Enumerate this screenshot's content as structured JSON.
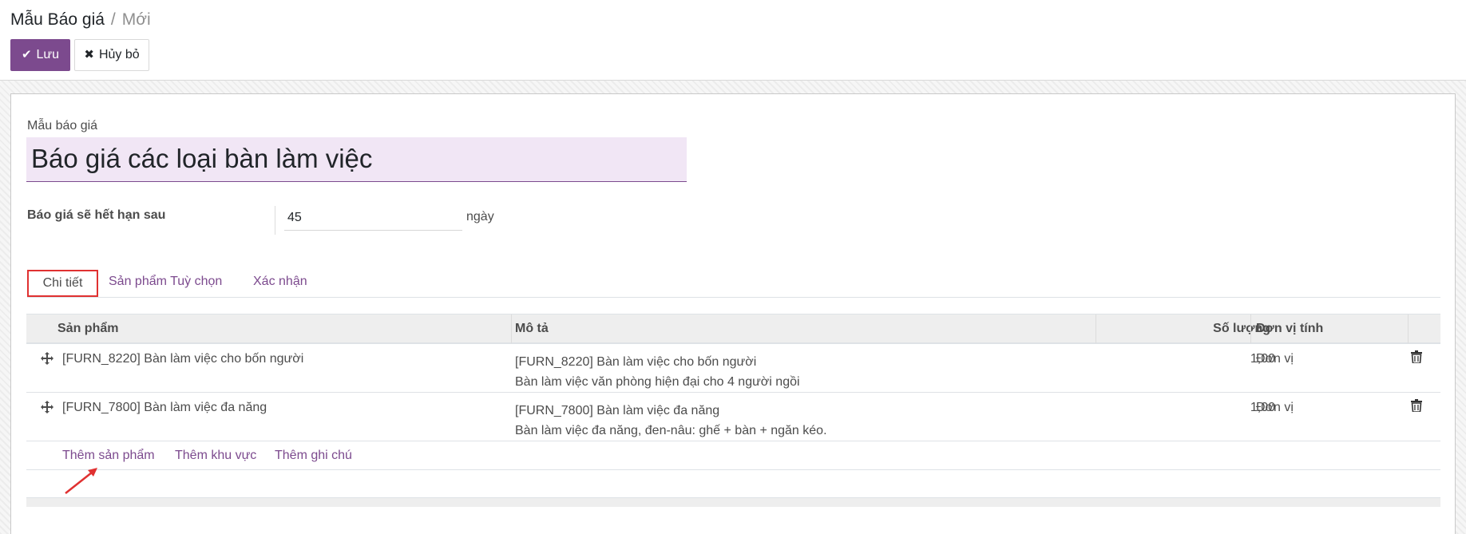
{
  "breadcrumb": {
    "parent": "Mẫu Báo giá",
    "separator": "/",
    "current": "Mới"
  },
  "toolbar": {
    "save_label": "Lưu",
    "discard_label": "Hủy bỏ"
  },
  "form": {
    "name_label": "Mẫu báo giá",
    "name_value": "Báo giá các loại bàn làm việc",
    "expiry_label": "Báo giá sẽ hết hạn sau",
    "expiry_value": "45",
    "expiry_unit": "ngày"
  },
  "tabs": [
    {
      "label": "Chi tiết",
      "active": true
    },
    {
      "label": "Sản phẩm Tuỳ chọn",
      "active": false
    },
    {
      "label": "Xác nhận",
      "active": false
    }
  ],
  "table": {
    "headers": {
      "product": "Sản phẩm",
      "description": "Mô tả",
      "quantity": "Số lượng",
      "uom": "Đơn vị tính"
    },
    "rows": [
      {
        "product": "[FURN_8220] Bàn làm việc cho bốn người",
        "desc_line1": "[FURN_8220] Bàn làm việc cho bốn người",
        "desc_line2": "Bàn làm việc văn phòng hiện đại cho 4 người ngồi",
        "quantity": "1,00",
        "uom": "Đơn vị"
      },
      {
        "product": "[FURN_7800] Bàn làm việc đa năng",
        "desc_line1": "[FURN_7800] Bàn làm việc đa năng",
        "desc_line2": "Bàn làm việc đa năng, đen-nâu: ghế + bàn + ngăn kéo.",
        "quantity": "1,00",
        "uom": "Đơn vị"
      }
    ],
    "add_links": {
      "product": "Thêm sản phẩm",
      "section": "Thêm khu vực",
      "note": "Thêm ghi chú"
    }
  },
  "colors": {
    "brand": "#7c4a8e",
    "highlight_border": "#e03131",
    "name_field_bg": "#f1e6f5"
  },
  "icons": [
    "check-icon",
    "times-icon",
    "drag-handle-icon",
    "trash-icon",
    "annotation-arrow-icon"
  ]
}
